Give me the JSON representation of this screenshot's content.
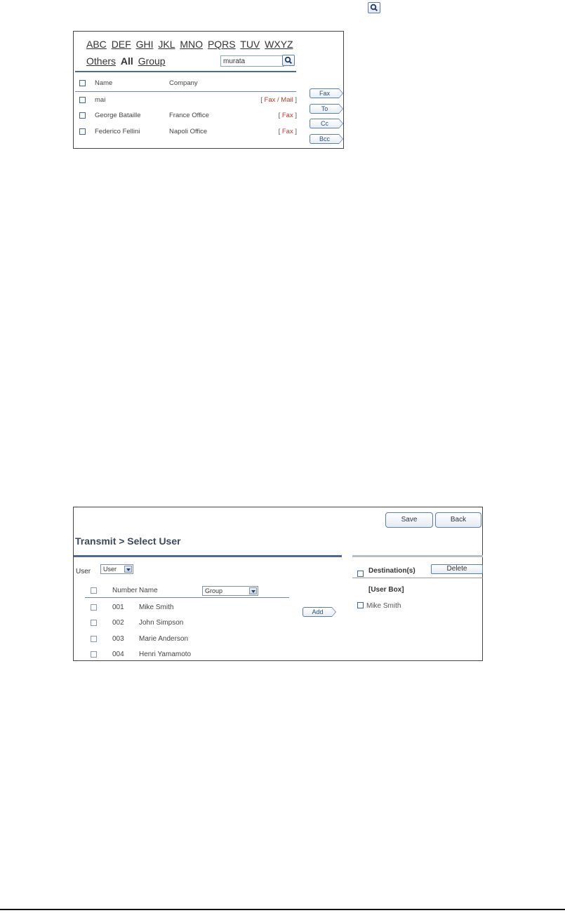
{
  "header_icon": "search-icon",
  "address_book": {
    "alphabet": [
      "ABC",
      "DEF",
      "GHI",
      "JKL",
      "MNO",
      "PQRS",
      "TUV",
      "WXYZ"
    ],
    "filters": {
      "others": "Others",
      "all": "All",
      "group": "Group"
    },
    "search": {
      "value": "murata"
    },
    "columns": {
      "name": "Name",
      "company": "Company"
    },
    "rows": [
      {
        "name": "mai",
        "company": "",
        "type": "Fax / Mail"
      },
      {
        "name": "George Bataille",
        "company": "France Office",
        "type": "Fax"
      },
      {
        "name": "Federico Fellini",
        "company": "Napoli Office",
        "type": "Fax"
      }
    ],
    "bracket_open": "[ ",
    "bracket_close": " ]",
    "buttons": {
      "fax": "Fax",
      "to": "To",
      "cc": "Cc",
      "bcc": "Bcc"
    }
  },
  "select_user": {
    "buttons": {
      "save": "Save",
      "back": "Back",
      "delete": "Delete",
      "add": "Add"
    },
    "title": "Transmit > Select User",
    "user_label": "User",
    "user_select": "User",
    "destinations_label": "Destination(s)",
    "columns": {
      "number": "Number",
      "name": "Name"
    },
    "group_select": "Group",
    "users": [
      {
        "number": "001",
        "name": "Mike Smith"
      },
      {
        "number": "002",
        "name": "John Simpson"
      },
      {
        "number": "003",
        "name": "Marie Anderson"
      },
      {
        "number": "004",
        "name": "Henri Yamamoto"
      }
    ],
    "user_box_label": "[User Box]",
    "destinations": [
      "Mike Smith"
    ]
  }
}
